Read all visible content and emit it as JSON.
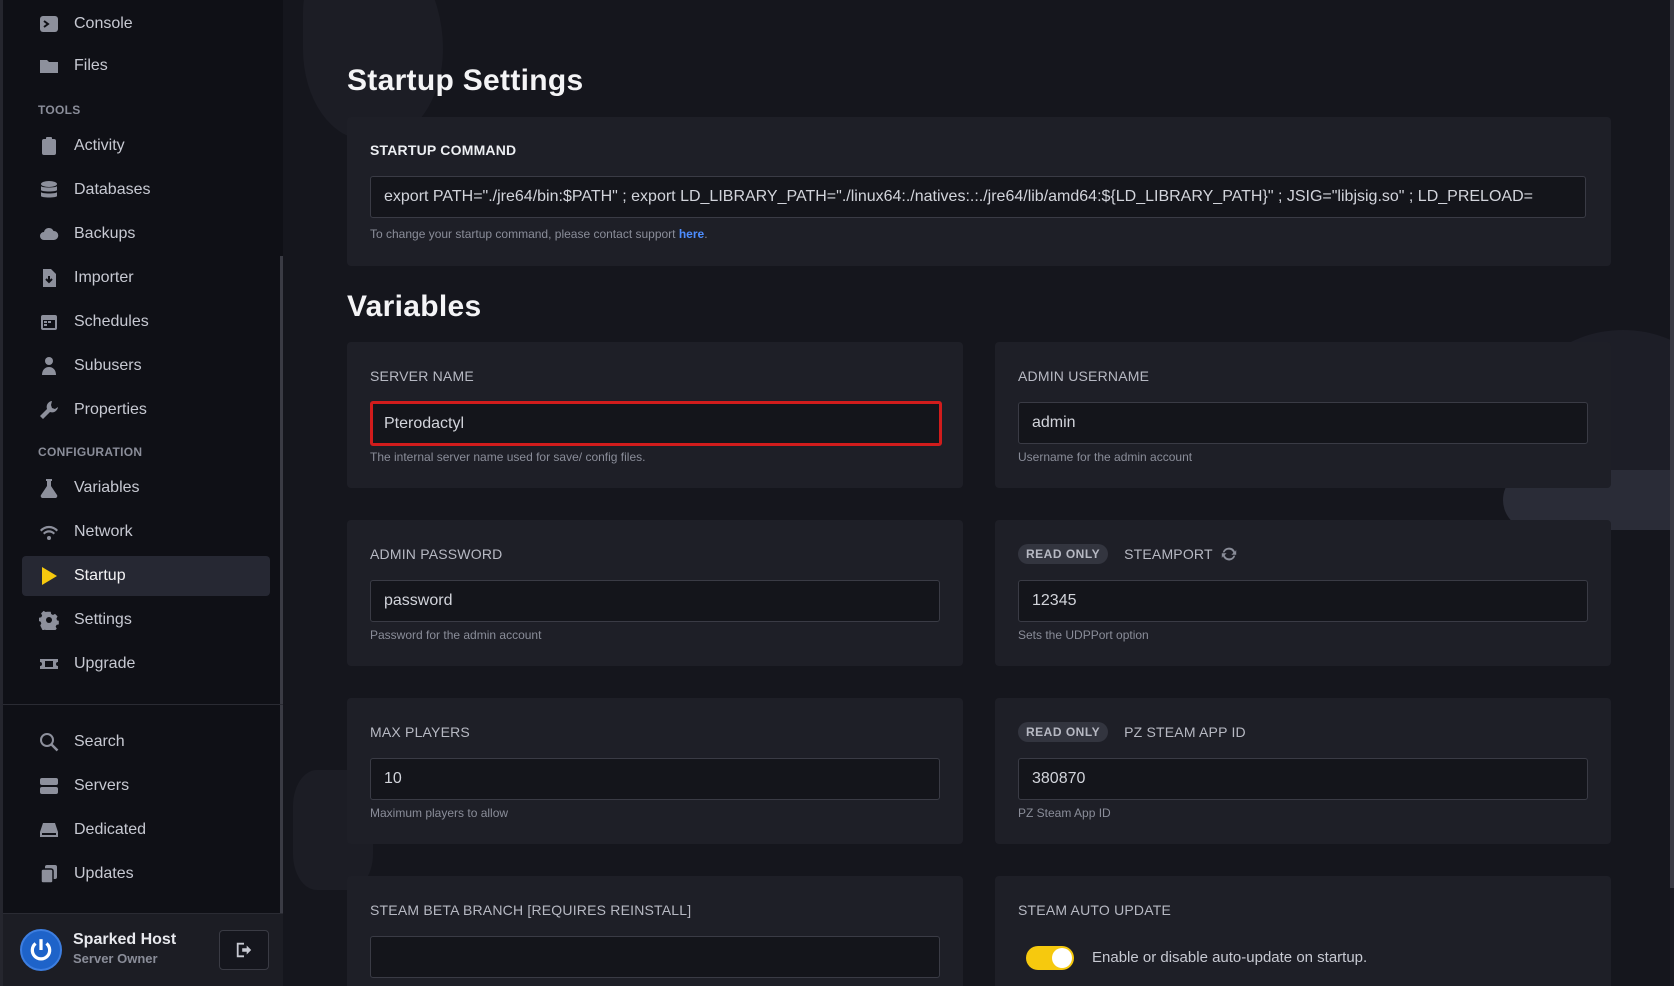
{
  "sidebar": {
    "top_items": [
      {
        "label": "Console",
        "icon": "terminal-icon"
      },
      {
        "label": "Files",
        "icon": "folder-icon"
      }
    ],
    "tools_heading": "TOOLS",
    "tools": [
      {
        "label": "Activity",
        "icon": "clipboard-icon"
      },
      {
        "label": "Databases",
        "icon": "database-icon"
      },
      {
        "label": "Backups",
        "icon": "cloud-icon"
      },
      {
        "label": "Importer",
        "icon": "file-import-icon"
      },
      {
        "label": "Schedules",
        "icon": "calendar-icon"
      },
      {
        "label": "Subusers",
        "icon": "user-icon"
      },
      {
        "label": "Properties",
        "icon": "wrench-icon"
      }
    ],
    "config_heading": "CONFIGURATION",
    "config": [
      {
        "label": "Variables",
        "icon": "flask-icon"
      },
      {
        "label": "Network",
        "icon": "wifi-icon"
      },
      {
        "label": "Startup",
        "icon": "play-icon",
        "active": true
      },
      {
        "label": "Settings",
        "icon": "gear-icon"
      },
      {
        "label": "Upgrade",
        "icon": "ticket-icon"
      }
    ],
    "bottom": [
      {
        "label": "Search",
        "icon": "search-icon"
      },
      {
        "label": "Servers",
        "icon": "server-icon"
      },
      {
        "label": "Dedicated",
        "icon": "hard-drive-icon"
      },
      {
        "label": "Updates",
        "icon": "copy-icon"
      }
    ],
    "user": {
      "name": "Sparked Host",
      "role": "Server Owner"
    }
  },
  "startup": {
    "title": "Startup Settings",
    "command_label": "STARTUP COMMAND",
    "command_value": "export PATH=\"./jre64/bin:$PATH\" ; export LD_LIBRARY_PATH=\"./linux64:./natives:.:./jre64/lib/amd64:${LD_LIBRARY_PATH}\" ; JSIG=\"libjsig.so\" ; LD_PRELOAD=",
    "help_prefix": "To change your startup command, please contact support ",
    "help_link": "here",
    "help_suffix": "."
  },
  "variables": {
    "title": "Variables",
    "read_only_badge": "READ ONLY",
    "server_name": {
      "label": "SERVER NAME",
      "value": "Pterodactyl",
      "help": "The internal server name used for save/ config files."
    },
    "admin_username": {
      "label": "ADMIN USERNAME",
      "value": "admin",
      "help": "Username for the admin account"
    },
    "admin_password": {
      "label": "ADMIN PASSWORD",
      "value": "password",
      "help": "Password for the admin account"
    },
    "steamport": {
      "label": "STEAMPORT",
      "value": "12345",
      "help": "Sets the UDPPort option"
    },
    "max_players": {
      "label": "MAX PLAYERS",
      "value": "10",
      "help": "Maximum players to allow"
    },
    "pz_app_id": {
      "label": "PZ STEAM APP ID",
      "value": "380870",
      "help": "PZ Steam App ID"
    },
    "beta_branch": {
      "label": "STEAM BETA BRANCH [REQUIRES REINSTALL]",
      "value": ""
    },
    "auto_update": {
      "label": "STEAM AUTO UPDATE",
      "text": "Enable or disable auto-update on startup.",
      "enabled": true
    }
  },
  "colors": {
    "accent": "#f6c90e",
    "highlight": "#d11c1c",
    "link": "#4d8dff"
  }
}
